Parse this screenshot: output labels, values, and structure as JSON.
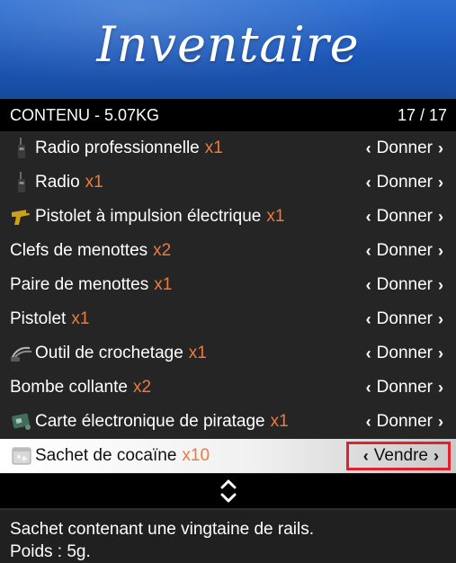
{
  "banner": {
    "title": "Inventaire",
    "color": "#1d58b8"
  },
  "header": {
    "label": "CONTENU - 5.07KG",
    "count": "17 / 17"
  },
  "items": [
    {
      "label": "Radio professionnelle",
      "qty": "x1",
      "icon": "radio-icon",
      "action": "Donner"
    },
    {
      "label": "Radio",
      "qty": "x1",
      "icon": "radio-icon",
      "action": "Donner"
    },
    {
      "label": "Pistolet à impulsion électrique",
      "qty": "x1",
      "icon": "taser-icon",
      "action": "Donner"
    },
    {
      "label": "Clefs de menottes",
      "qty": "x2",
      "icon": "",
      "action": "Donner"
    },
    {
      "label": "Paire de menottes",
      "qty": "x1",
      "icon": "",
      "action": "Donner"
    },
    {
      "label": "Pistolet",
      "qty": "x1",
      "icon": "",
      "action": "Donner"
    },
    {
      "label": "Outil de crochetage",
      "qty": "x1",
      "icon": "lockpick-icon",
      "action": "Donner"
    },
    {
      "label": "Bombe collante",
      "qty": "x2",
      "icon": "",
      "action": "Donner"
    },
    {
      "label": "Carte électronique de piratage",
      "qty": "x1",
      "icon": "hacking-card-icon",
      "action": "Donner"
    },
    {
      "label": "Sachet de cocaïne",
      "qty": "x10",
      "icon": "cocaine-bag-icon",
      "action": "Vendre",
      "selected": true
    }
  ],
  "description": {
    "line1": "Sachet contenant une vingtaine de rails.",
    "line2": "Poids : 5g."
  },
  "colors": {
    "quantity": "#f07a3c",
    "highlight_border": "#e5202d",
    "header_bg": "#000000"
  }
}
